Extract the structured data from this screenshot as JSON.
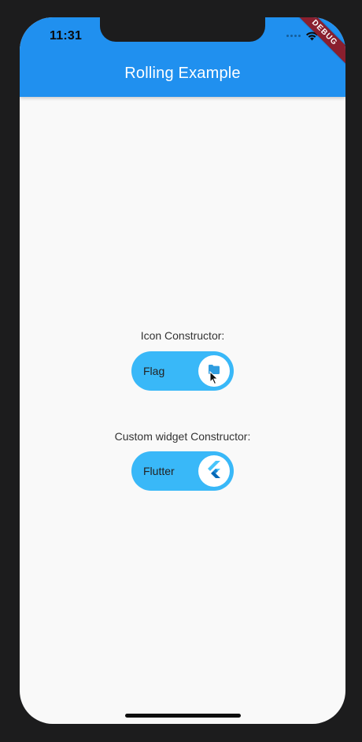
{
  "status_bar": {
    "time": "11:31"
  },
  "app_bar": {
    "title": "Rolling Example",
    "debug_banner": "DEBUG",
    "color": "#2090ef"
  },
  "icon_switch": {
    "caption": "Icon Constructor:",
    "label": "Flag",
    "icon": "folder-icon",
    "color": "#39b8f8"
  },
  "custom_switch": {
    "caption": "Custom widget Constructor:",
    "label": "Flutter",
    "icon": "flutter-logo-icon",
    "color": "#39b8f8"
  }
}
